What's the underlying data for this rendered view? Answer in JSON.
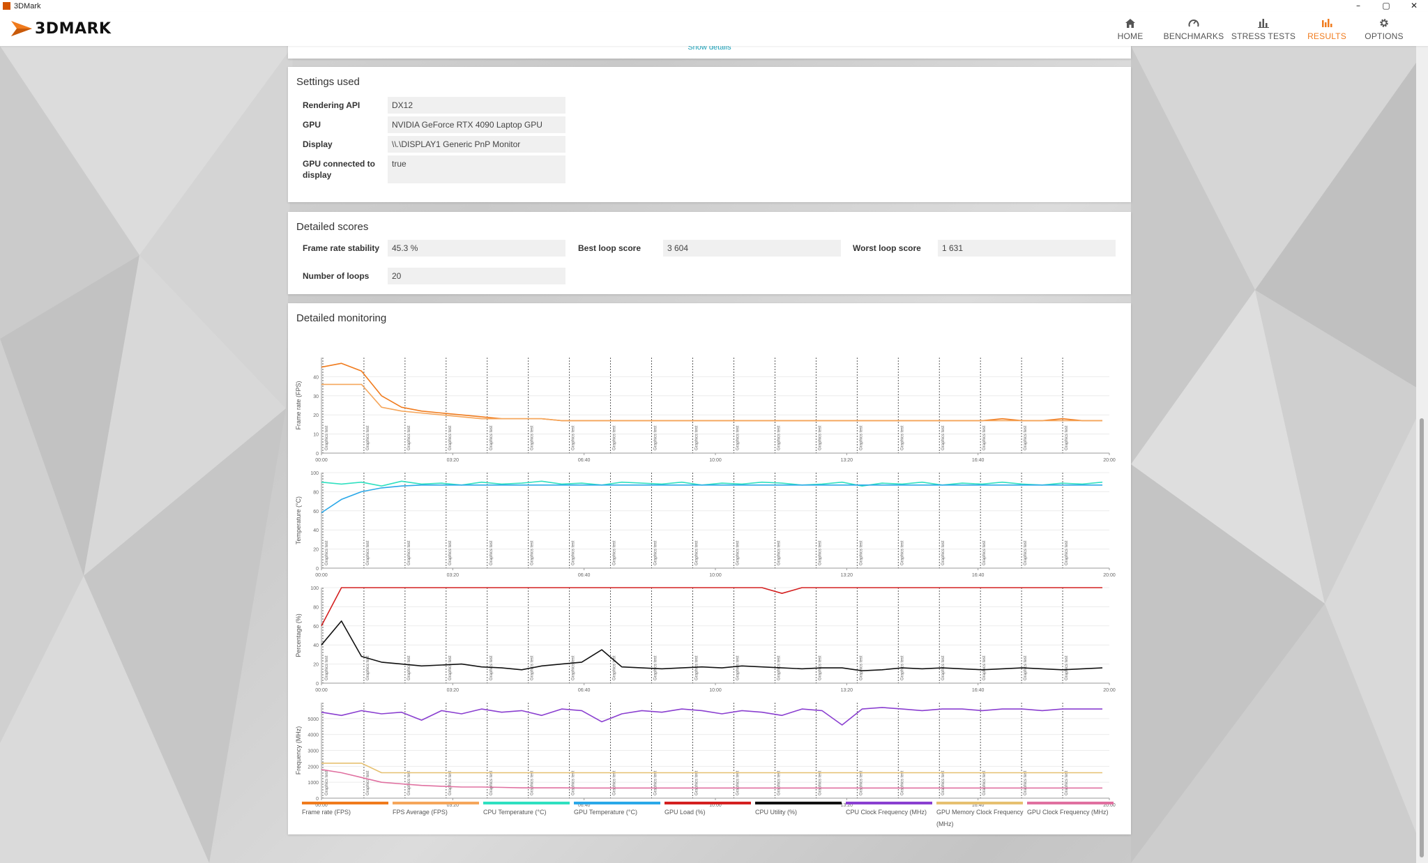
{
  "window": {
    "title": "3DMark",
    "controls": [
      "–",
      "▢",
      "✕"
    ]
  },
  "app": {
    "logo_text": "3DMARK"
  },
  "nav": [
    {
      "id": "home",
      "label": "HOME",
      "icon": "home-icon",
      "active": false
    },
    {
      "id": "benchmarks",
      "label": "BENCHMARKS",
      "icon": "gauge-icon",
      "active": false
    },
    {
      "id": "stress",
      "label": "STRESS TESTS",
      "icon": "bar-chart-icon",
      "active": false
    },
    {
      "id": "results",
      "label": "RESULTS",
      "icon": "results-icon",
      "active": true
    },
    {
      "id": "options",
      "label": "OPTIONS",
      "icon": "gear-icon",
      "active": false
    }
  ],
  "top_panel": {
    "show_details": "Show details"
  },
  "settings": {
    "title": "Settings used",
    "rows": [
      {
        "key": "Rendering API",
        "value": "DX12"
      },
      {
        "key": "GPU",
        "value": "NVIDIA GeForce RTX 4090 Laptop GPU"
      },
      {
        "key": "Display",
        "value": "\\\\.\\DISPLAY1 Generic PnP Monitor"
      },
      {
        "key": "GPU connected to display",
        "value": "true"
      }
    ]
  },
  "scores": {
    "title": "Detailed scores",
    "frame_rate_stability": {
      "key": "Frame rate stability",
      "value": "45.3 %"
    },
    "best_loop": {
      "key": "Best loop score",
      "value": "3 604"
    },
    "worst_loop": {
      "key": "Worst loop score",
      "value": "1 631"
    },
    "loops": {
      "key": "Number of loops",
      "value": "20"
    }
  },
  "monitoring": {
    "title": "Detailed monitoring",
    "marker_label": "Graphics test",
    "x_ticks": [
      "00:00",
      "03:20",
      "06:40",
      "10:00",
      "13:20",
      "16:40",
      "20:00"
    ],
    "legend": [
      {
        "label": "Frame rate (FPS)",
        "color": "#f07b1d"
      },
      {
        "label": "FPS Average (FPS)",
        "color": "#f5a65b"
      },
      {
        "label": "CPU Temperature (°C)",
        "color": "#2fe0c0"
      },
      {
        "label": "GPU Temperature (°C)",
        "color": "#2aa8e8"
      },
      {
        "label": "GPU Load (%)",
        "color": "#d42020"
      },
      {
        "label": "CPU Utility (%)",
        "color": "#111111"
      },
      {
        "label": "CPU Clock Frequency (MHz)",
        "color": "#8a3fd0"
      },
      {
        "label": "GPU Memory Clock Frequency (MHz)",
        "color": "#e6c070"
      },
      {
        "label": "GPU Clock Frequency (MHz)",
        "color": "#e070a0"
      }
    ]
  },
  "chart_data": [
    {
      "type": "line",
      "ylabel": "Frame rate (FPS)",
      "ylim": [
        0,
        50
      ],
      "y_ticks": [
        0,
        10,
        20,
        30,
        40
      ],
      "x_range": [
        "00:00",
        "20:00"
      ],
      "series": [
        {
          "name": "Frame rate (FPS)",
          "color": "#f07b1d",
          "values": [
            45,
            47,
            43,
            30,
            24,
            22,
            21,
            20,
            19,
            18,
            18,
            18,
            17,
            17,
            17,
            17,
            17,
            17,
            17,
            17,
            17,
            17,
            17,
            17,
            17,
            17,
            17,
            17,
            17,
            17,
            17,
            17,
            17,
            17,
            18,
            17,
            17,
            18,
            17,
            17
          ]
        },
        {
          "name": "FPS Average (FPS)",
          "color": "#f5a65b",
          "values": [
            36,
            36,
            36,
            24,
            22,
            21,
            20,
            19,
            18,
            18,
            18,
            18,
            17,
            17,
            17,
            17,
            17,
            17,
            17,
            17,
            17,
            17,
            17,
            17,
            17,
            17,
            17,
            17,
            17,
            17,
            17,
            17,
            17,
            17,
            17,
            17,
            17,
            17,
            17,
            17
          ]
        }
      ]
    },
    {
      "type": "line",
      "ylabel": "Temperature (°C)",
      "ylim": [
        0,
        100
      ],
      "y_ticks": [
        0,
        20,
        40,
        60,
        80,
        100
      ],
      "x_range": [
        "00:00",
        "20:00"
      ],
      "series": [
        {
          "name": "CPU Temperature (°C)",
          "color": "#2fe0c0",
          "values": [
            90,
            88,
            90,
            86,
            91,
            88,
            89,
            87,
            90,
            88,
            89,
            91,
            88,
            89,
            87,
            90,
            89,
            88,
            90,
            87,
            89,
            88,
            90,
            89,
            87,
            88,
            90,
            86,
            89,
            88,
            90,
            87,
            89,
            88,
            90,
            88,
            87,
            89,
            88,
            90
          ]
        },
        {
          "name": "GPU Temperature (°C)",
          "color": "#2aa8e8",
          "values": [
            58,
            72,
            80,
            84,
            86,
            87,
            87,
            87,
            87,
            87,
            87,
            87,
            87,
            87,
            87,
            87,
            87,
            87,
            87,
            87,
            87,
            87,
            87,
            87,
            87,
            87,
            87,
            87,
            87,
            87,
            87,
            87,
            87,
            87,
            87,
            87,
            87,
            87,
            87,
            87
          ]
        }
      ]
    },
    {
      "type": "line",
      "ylabel": "Percentage (%)",
      "ylim": [
        0,
        100
      ],
      "y_ticks": [
        0,
        20,
        40,
        60,
        80,
        100
      ],
      "x_range": [
        "00:00",
        "20:00"
      ],
      "series": [
        {
          "name": "GPU Load (%)",
          "color": "#d42020",
          "values": [
            60,
            100,
            100,
            100,
            100,
            100,
            100,
            100,
            100,
            100,
            100,
            100,
            100,
            100,
            100,
            100,
            100,
            100,
            100,
            100,
            100,
            100,
            100,
            94,
            100,
            100,
            100,
            100,
            100,
            100,
            100,
            100,
            100,
            100,
            100,
            100,
            100,
            100,
            100,
            100
          ]
        },
        {
          "name": "CPU Utility (%)",
          "color": "#111111",
          "values": [
            40,
            65,
            28,
            22,
            20,
            18,
            19,
            20,
            17,
            16,
            14,
            18,
            20,
            22,
            35,
            17,
            16,
            15,
            16,
            17,
            16,
            18,
            17,
            16,
            15,
            16,
            16,
            13,
            14,
            16,
            15,
            16,
            15,
            14,
            15,
            16,
            15,
            14,
            15,
            16
          ]
        }
      ]
    },
    {
      "type": "line",
      "ylabel": "Frequency (MHz)",
      "ylim": [
        0,
        6000
      ],
      "y_ticks": [
        0,
        1000,
        2000,
        3000,
        4000,
        5000
      ],
      "x_range": [
        "00:00",
        "20:00"
      ],
      "series": [
        {
          "name": "CPU Clock Frequency (MHz)",
          "color": "#8a3fd0",
          "values": [
            5400,
            5200,
            5500,
            5300,
            5400,
            4900,
            5500,
            5300,
            5600,
            5400,
            5500,
            5200,
            5600,
            5500,
            4800,
            5300,
            5500,
            5400,
            5600,
            5500,
            5300,
            5500,
            5400,
            5200,
            5600,
            5500,
            4600,
            5600,
            5700,
            5600,
            5500,
            5600,
            5600,
            5500,
            5600,
            5600,
            5500,
            5600,
            5600,
            5600
          ]
        },
        {
          "name": "GPU Memory Clock Frequency (MHz)",
          "color": "#e6c070",
          "values": [
            2200,
            2200,
            2200,
            1600,
            1600,
            1600,
            1600,
            1600,
            1600,
            1600,
            1600,
            1600,
            1600,
            1600,
            1600,
            1600,
            1600,
            1600,
            1600,
            1600,
            1600,
            1600,
            1600,
            1600,
            1600,
            1600,
            1600,
            1600,
            1600,
            1600,
            1600,
            1600,
            1600,
            1600,
            1600,
            1600,
            1600,
            1600,
            1600,
            1600
          ]
        },
        {
          "name": "GPU Clock Frequency (MHz)",
          "color": "#e070a0",
          "values": [
            1800,
            1600,
            1300,
            1000,
            900,
            800,
            750,
            700,
            700,
            680,
            650,
            650,
            650,
            640,
            640,
            640,
            640,
            640,
            640,
            640,
            640,
            640,
            640,
            640,
            640,
            640,
            640,
            640,
            640,
            640,
            640,
            640,
            640,
            640,
            640,
            640,
            640,
            640,
            640,
            640
          ]
        }
      ]
    }
  ]
}
